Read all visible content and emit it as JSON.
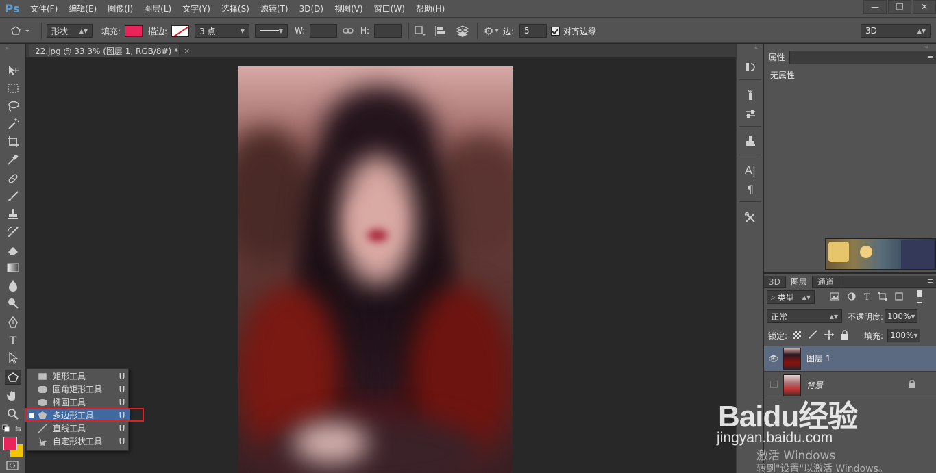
{
  "menubar": {
    "logo": "Ps",
    "items": [
      "文件(F)",
      "编辑(E)",
      "图像(I)",
      "图层(L)",
      "文字(Y)",
      "选择(S)",
      "滤镜(T)",
      "3D(D)",
      "视图(V)",
      "窗口(W)",
      "帮助(H)"
    ],
    "window_controls": [
      "—",
      "❐",
      "✕"
    ]
  },
  "optionsbar": {
    "mode": "形状",
    "fill_label": "填充:",
    "fill_color": "#e8245a",
    "stroke_label": "描边:",
    "stroke_size": "3 点",
    "w_label": "W:",
    "h_label": "H:",
    "sides_label": "边:",
    "sides_value": "5",
    "align_edges_label": "对齐边缘",
    "workspace": "3D"
  },
  "document": {
    "tab_title": "22.jpg @ 33.3% (图层 1, RGB/8#) *",
    "tab_close": "×"
  },
  "flyout": {
    "items": [
      {
        "label": "矩形工具",
        "key": "U",
        "icon": "rectangle-icon",
        "selected": false
      },
      {
        "label": "圆角矩形工具",
        "key": "U",
        "icon": "rounded-rectangle-icon",
        "selected": false
      },
      {
        "label": "椭圆工具",
        "key": "U",
        "icon": "ellipse-icon",
        "selected": false
      },
      {
        "label": "多边形工具",
        "key": "U",
        "icon": "polygon-icon",
        "selected": true
      },
      {
        "label": "直线工具",
        "key": "U",
        "icon": "line-icon",
        "selected": false
      },
      {
        "label": "自定形状工具",
        "key": "U",
        "icon": "custom-shape-icon",
        "selected": false
      }
    ]
  },
  "colors": {
    "foreground": "#e8245a",
    "background": "#f5c400",
    "highlight": "#e02020",
    "accent": "#3f6aa0"
  },
  "properties": {
    "tab": "属性",
    "empty_text": "无属性"
  },
  "layers": {
    "tabs": [
      "3D",
      "图层",
      "通道"
    ],
    "filter_kind": "类型",
    "blend_mode": "正常",
    "opacity_label": "不透明度:",
    "opacity_value": "100%",
    "lock_label": "锁定:",
    "fill_label": "填充:",
    "fill_value": "100%",
    "items": [
      {
        "name": "图层 1",
        "visible": true,
        "active": true,
        "locked": false
      },
      {
        "name": "背景",
        "visible": false,
        "active": false,
        "locked": true
      }
    ]
  },
  "watermark": {
    "logo": "Baidu经验",
    "url": "jingyan.baidu.com",
    "activate_title": "激活 Windows",
    "activate_sub": "转到\"设置\"以激活 Windows。"
  }
}
